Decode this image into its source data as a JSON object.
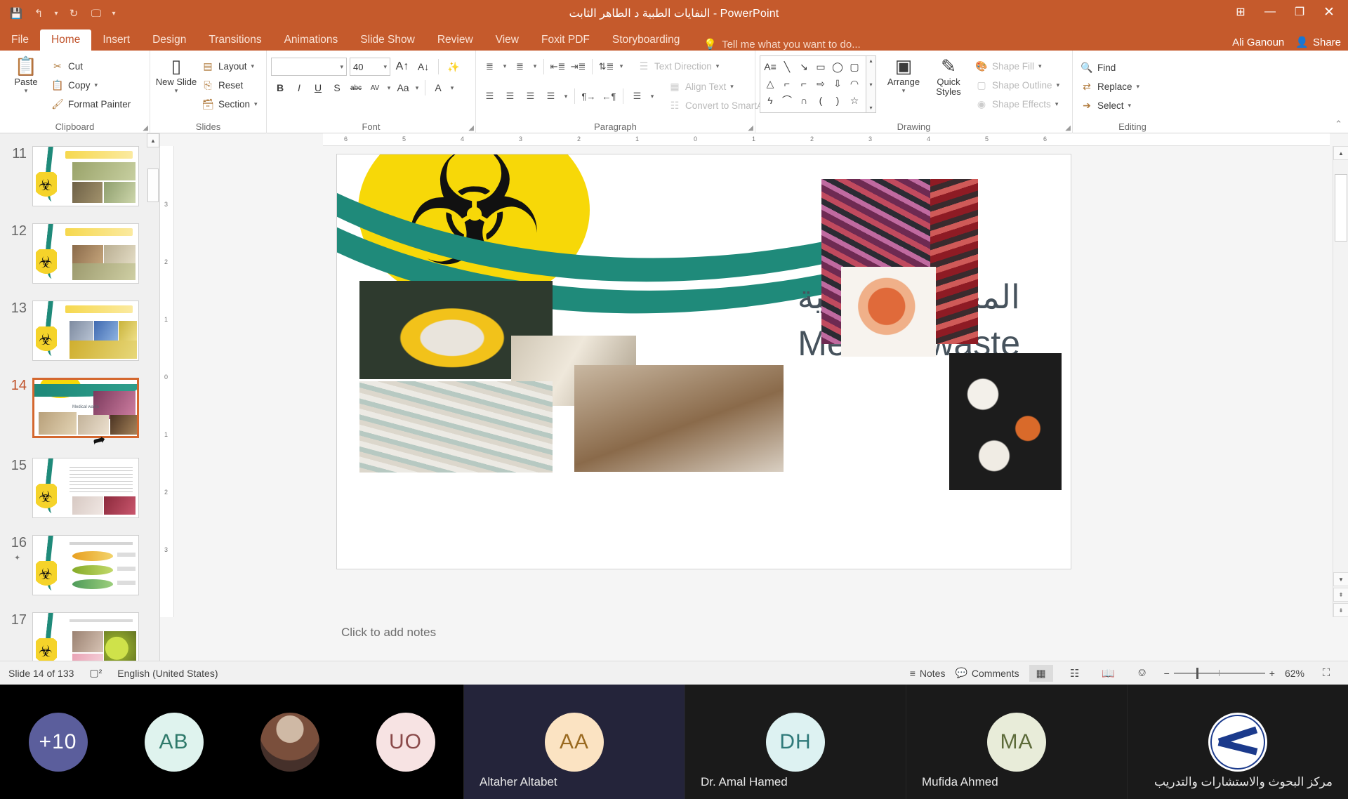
{
  "window": {
    "title": "النفايات الطبية د الطاهر الثابت - PowerPoint",
    "qat": [
      {
        "name": "save-icon",
        "glyph": "💾"
      },
      {
        "name": "undo-icon",
        "glyph": "↩"
      },
      {
        "name": "undo-dropdown-icon",
        "glyph": "▾"
      },
      {
        "name": "redo-icon",
        "glyph": "↻"
      },
      {
        "name": "start-presentation-icon",
        "glyph": "🖵"
      },
      {
        "name": "customize-qat-icon",
        "glyph": "▾"
      }
    ],
    "controls": {
      "ribbon_display_options": "⊞",
      "minimize": "—",
      "restore": "❐",
      "close": "✕"
    }
  },
  "ribbon": {
    "tabs": [
      {
        "label": "File",
        "active": false
      },
      {
        "label": "Home",
        "active": true
      },
      {
        "label": "Insert",
        "active": false
      },
      {
        "label": "Design",
        "active": false
      },
      {
        "label": "Transitions",
        "active": false
      },
      {
        "label": "Animations",
        "active": false
      },
      {
        "label": "Slide Show",
        "active": false
      },
      {
        "label": "Review",
        "active": false
      },
      {
        "label": "View",
        "active": false
      },
      {
        "label": "Foxit PDF",
        "active": false
      },
      {
        "label": "Storyboarding",
        "active": false
      }
    ],
    "tell_me": "Tell me what you want to do...",
    "user_name": "Ali Ganoun",
    "share_label": "Share",
    "collapse_ribbon": "⌃",
    "groups": {
      "clipboard": {
        "label": "Clipboard",
        "paste": "Paste",
        "cut": "Cut",
        "copy": "Copy",
        "format_painter": "Format Painter"
      },
      "slides": {
        "label": "Slides",
        "new_slide": "New Slide",
        "layout": "Layout",
        "reset": "Reset",
        "section": "Section"
      },
      "font": {
        "label": "Font",
        "font_name": "",
        "font_name_placeholder": "",
        "font_size": "40",
        "bold": "B",
        "italic": "I",
        "underline": "U",
        "shadow": "S",
        "strikethrough": "abc",
        "char_spacing": "AV",
        "change_case": "Aa",
        "font_color": "A",
        "increase_size": "A",
        "decrease_size": "A",
        "clear_formatting": "✦"
      },
      "paragraph": {
        "label": "Paragraph",
        "text_direction": "Text Direction",
        "align_text": "Align Text",
        "convert_to_smartart": "Convert to SmartArt"
      },
      "drawing": {
        "label": "Drawing",
        "arrange": "Arrange",
        "quick_styles": "Quick Styles",
        "shape_fill": "Shape Fill",
        "shape_outline": "Shape Outline",
        "shape_effects": "Shape Effects",
        "shapes": [
          "A≡",
          "╲",
          "↘",
          "▭",
          "◯",
          "▢",
          "△",
          "⌐",
          "⌐",
          "⇨",
          "⇩",
          "◠",
          "ϟ",
          "⌒",
          "∩",
          "(",
          ")",
          "☆"
        ]
      },
      "editing": {
        "label": "Editing",
        "find": "Find",
        "replace": "Replace",
        "select": "Select"
      }
    }
  },
  "thumbnails": [
    {
      "number": "11",
      "selected": false,
      "animated": false
    },
    {
      "number": "12",
      "selected": false,
      "animated": false
    },
    {
      "number": "13",
      "selected": false,
      "animated": false
    },
    {
      "number": "14",
      "selected": true,
      "animated": false
    },
    {
      "number": "15",
      "selected": false,
      "animated": false
    },
    {
      "number": "16",
      "selected": false,
      "animated": true
    },
    {
      "number": "17",
      "selected": false,
      "animated": false
    }
  ],
  "slide": {
    "title_arabic": "المخلفات الطبية",
    "title_english": "Medical waste",
    "notes_placeholder": "Click to add notes",
    "ruler_h": [
      "6",
      "5",
      "4",
      "3",
      "2",
      "1",
      "0",
      "1",
      "2",
      "3",
      "4",
      "5",
      "6"
    ],
    "ruler_v": [
      "3",
      "2",
      "1",
      "0",
      "1",
      "2",
      "3"
    ],
    "colors": {
      "biohazard_yellow": "#f7d808",
      "swoosh_teal": "#1f8a7a",
      "title_text": "#46525c"
    }
  },
  "status_bar": {
    "slide_counter": "Slide 14 of 133",
    "language": "English (United States)",
    "notes_label": "Notes",
    "comments_label": "Comments",
    "zoom_percent": "62%",
    "zoom_out": "−",
    "zoom_in": "+",
    "views": [
      "normal-view",
      "slide-sorter-view",
      "reading-view",
      "slide-show-view"
    ],
    "fit_slide": "⛶"
  },
  "conference": {
    "tiles": [
      {
        "initials": "+10",
        "name": "",
        "kind": "overflow",
        "bg": "#5b5e9c",
        "fg": "#ffffff"
      },
      {
        "initials": "AB",
        "name": "",
        "kind": "initials",
        "bg": "#dff3ee",
        "fg": "#2f7a6b"
      },
      {
        "initials": "",
        "name": "",
        "kind": "photo",
        "bg": "#6b4a3e",
        "fg": "#ffffff"
      },
      {
        "initials": "UO",
        "name": "",
        "kind": "initials",
        "bg": "#f7e3e3",
        "fg": "#8a4a4a"
      },
      {
        "initials": "AA",
        "name": "Altaher Altabet",
        "kind": "initials",
        "bg": "#fbe3c2",
        "fg": "#9a6a20"
      },
      {
        "initials": "DH",
        "name": "Dr. Amal Hamed",
        "kind": "initials",
        "bg": "#ddf2f2",
        "fg": "#2f7a7a"
      },
      {
        "initials": "MA",
        "name": "Mufida Ahmed",
        "kind": "initials",
        "bg": "#e8ecd9",
        "fg": "#5d6b3a"
      },
      {
        "initials": "",
        "name": "مركز البحوث والاستشارات والتدريب",
        "kind": "logo",
        "bg": "#ffffff",
        "fg": "#1b3a8c"
      }
    ]
  }
}
